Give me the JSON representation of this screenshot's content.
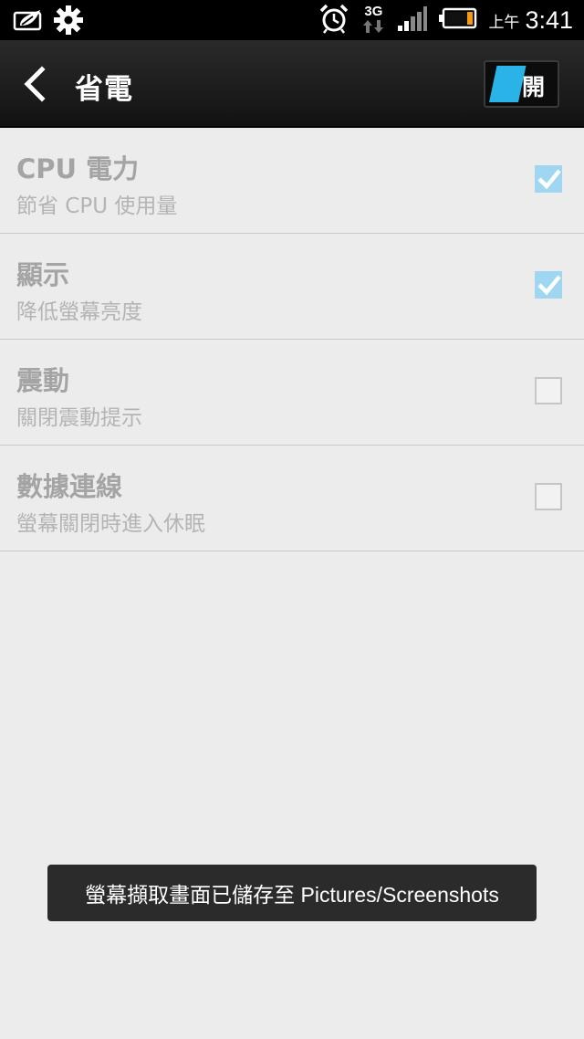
{
  "status_bar": {
    "network_label": "3G",
    "ampm": "上午",
    "time": "3:41",
    "icons": [
      "leaf-battery-saver-icon",
      "gear-icon",
      "alarm-clock-icon",
      "data-arrows-icon",
      "signal-bars-icon",
      "battery-icon"
    ]
  },
  "action_bar": {
    "title": "省電",
    "toggle_label": "開",
    "toggle_state": "on",
    "accent_color": "#29b3e6"
  },
  "settings": [
    {
      "title": "CPU 電力",
      "subtitle": "節省 CPU 使用量",
      "checked": true
    },
    {
      "title": "顯示",
      "subtitle": "降低螢幕亮度",
      "checked": true
    },
    {
      "title": "震動",
      "subtitle": "關閉震動提示",
      "checked": false
    },
    {
      "title": "數據連線",
      "subtitle": "螢幕關閉時進入休眠",
      "checked": false
    }
  ],
  "toast": {
    "message": "螢幕擷取畫面已儲存至 Pictures/Screenshots"
  }
}
